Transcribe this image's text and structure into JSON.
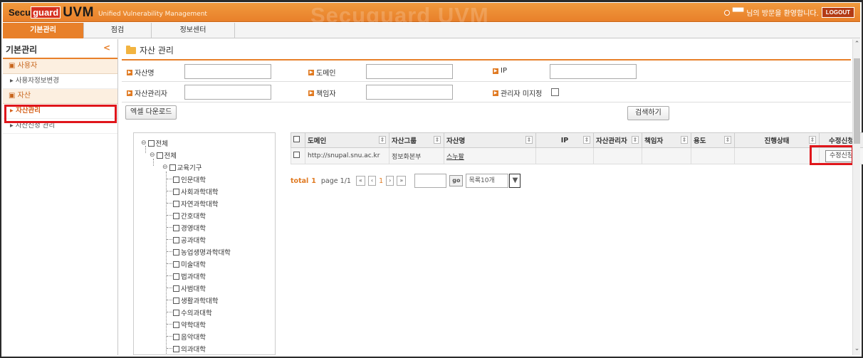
{
  "header": {
    "logo_secu": "Secu",
    "logo_guard": "guard",
    "logo_uvm": "UVM",
    "logo_sub": "Unified Vulnerability Management",
    "watermark": "Secuguard UVM",
    "welcome": "님의 방문을 환영합니다.",
    "user_name": "▀▀",
    "logout": "LOGOUT"
  },
  "nav": {
    "items": [
      "기본관리",
      "점검",
      "정보센터"
    ]
  },
  "sidebar": {
    "title": "기본관리",
    "collapse": "<",
    "groups": [
      {
        "label": "사용자",
        "items": [
          "사용자정보변경"
        ]
      },
      {
        "label": "자산",
        "items": [
          "자산관리",
          "자산신청 관리"
        ]
      }
    ]
  },
  "page": {
    "title": "자산 관리"
  },
  "search": {
    "asset_name": "자산명",
    "domain": "도메인",
    "ip": "IP",
    "asset_manager": "자산관리자",
    "responsible": "책임자",
    "no_manager": "관리자 미지정",
    "excel_download": "엑셀 다운로드",
    "search_button": "검색하기"
  },
  "tree": {
    "root": "전체",
    "sub": "전체",
    "org": "교육기구",
    "colleges": [
      "인문대학",
      "사회과학대학",
      "자연과학대학",
      "간호대학",
      "경영대학",
      "공과대학",
      "농업생명과학대학",
      "미술대학",
      "법과대학",
      "사범대학",
      "생활과학대학",
      "수의과대학",
      "약학대학",
      "음악대학",
      "의과대학"
    ]
  },
  "table": {
    "headers": [
      "도메인",
      "자산그룹",
      "자산명",
      "IP",
      "자산관리자",
      "책임자",
      "용도",
      "진행상태",
      "수정신청"
    ],
    "rows": [
      {
        "domain": "http://snupal.snu.ac.kr",
        "group": "정보화본부",
        "name": "스누팔",
        "ip": "",
        "manager": "",
        "responsible": "",
        "purpose": "",
        "status": "",
        "edit": "수정신청"
      }
    ]
  },
  "pager": {
    "total_label": "total",
    "total": "1",
    "page_label": "page 1/1",
    "first": "«",
    "prev": "‹",
    "current": "1",
    "next": "›",
    "last": "»",
    "go": "go",
    "per_page": "목록10개",
    "dropdown_arrow": "▼"
  },
  "colors": {
    "accent": "#e8802a",
    "highlight": "#e0161b"
  }
}
